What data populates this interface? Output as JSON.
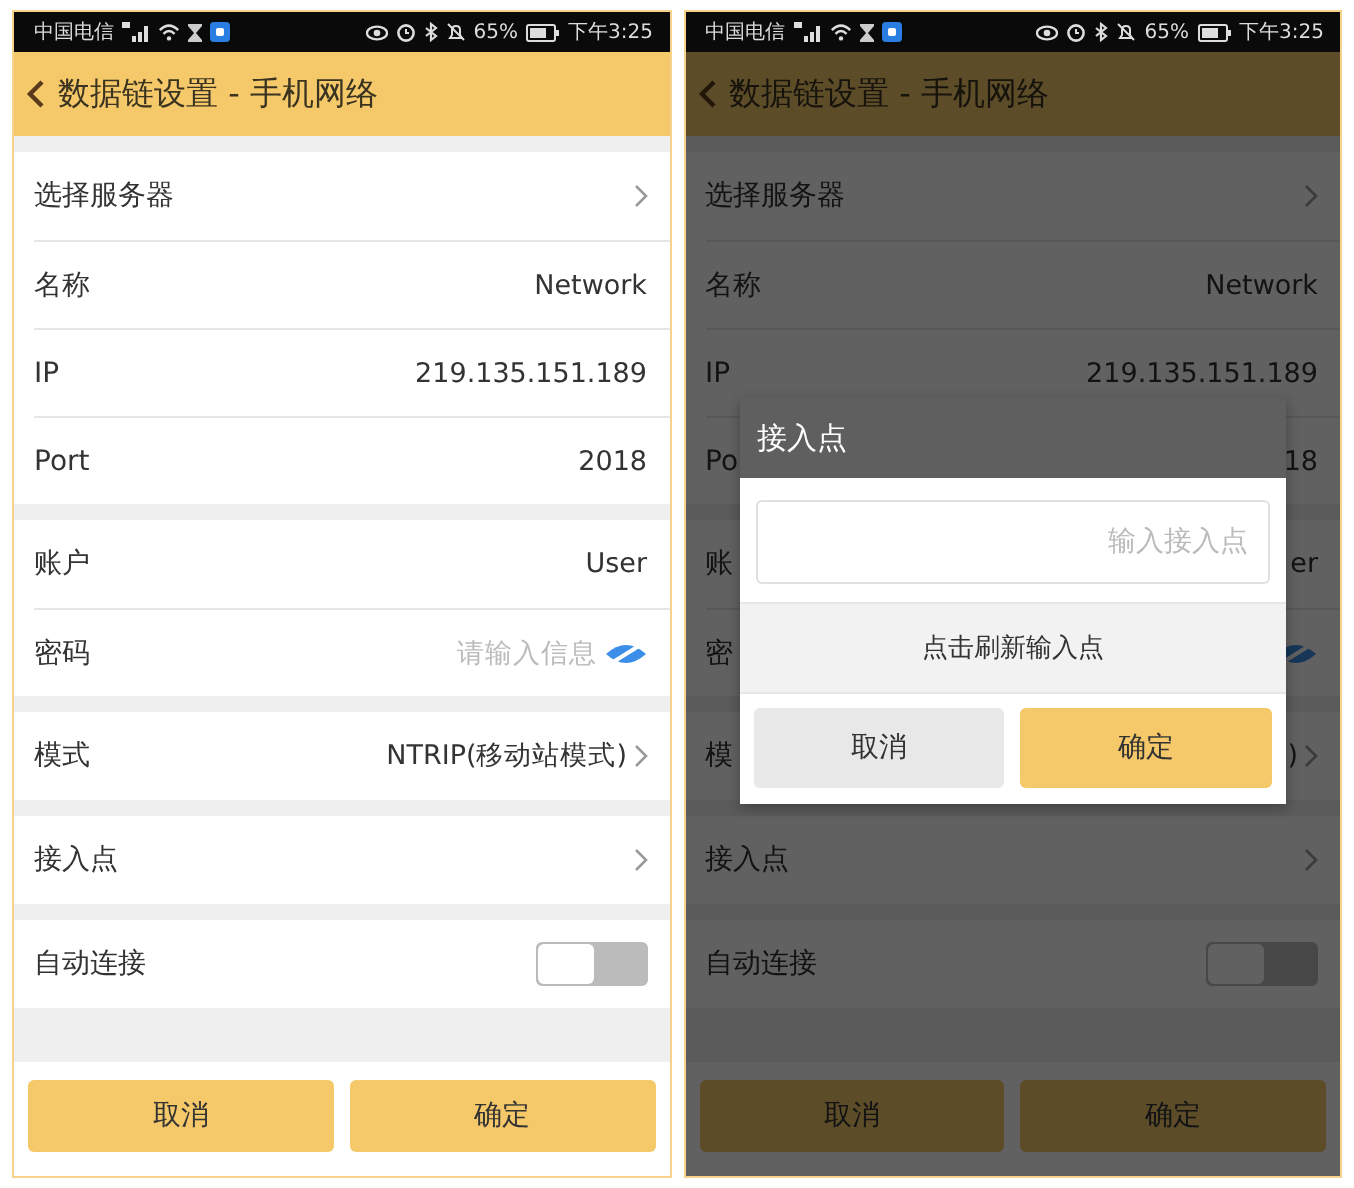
{
  "screens": [
    {
      "status_bar": {
        "carrier": "中国电信",
        "battery": "65%",
        "time": "下午3:25"
      },
      "header": {
        "title": "数据链设置 - 手机网络"
      },
      "groups": [
        {
          "rows": [
            {
              "kind": "link",
              "label": "选择服务器"
            },
            {
              "kind": "text",
              "label": "名称",
              "value": "Network"
            },
            {
              "kind": "text",
              "label": "IP",
              "value": "219.135.151.189"
            },
            {
              "kind": "text",
              "label": "Port",
              "value": "2018"
            }
          ]
        },
        {
          "rows": [
            {
              "kind": "text",
              "label": "账户",
              "value": "User"
            },
            {
              "kind": "password",
              "label": "密码",
              "placeholder": "请输入信息"
            }
          ]
        },
        {
          "rows": [
            {
              "kind": "link",
              "label": "模式",
              "value": "NTRIP(移动站模式)"
            }
          ]
        },
        {
          "rows": [
            {
              "kind": "link",
              "label": "接入点"
            }
          ]
        },
        {
          "rows": [
            {
              "kind": "toggle",
              "label": "自动连接",
              "on": false
            }
          ]
        }
      ],
      "buttons": [
        "取消",
        "确定"
      ]
    },
    {
      "status_bar": {
        "carrier": "中国电信",
        "battery": "65%",
        "time": "下午3:25"
      },
      "header": {
        "title": "数据链设置 - 手机网络"
      },
      "groups": [
        {
          "rows": [
            {
              "kind": "link",
              "label": "选择服务器"
            },
            {
              "kind": "text",
              "label": "名称",
              "value": "Network"
            },
            {
              "kind": "text",
              "label": "IP",
              "value": "219.135.151.189"
            },
            {
              "kind": "text",
              "label": "Po",
              "value": "18"
            }
          ]
        },
        {
          "rows": [
            {
              "kind": "text",
              "label": "账",
              "value": "er"
            },
            {
              "kind": "password",
              "label": "密"
            }
          ]
        },
        {
          "rows": [
            {
              "kind": "link",
              "label": "模",
              "value": ")"
            }
          ]
        },
        {
          "rows": [
            {
              "kind": "link",
              "label": "接入点"
            }
          ]
        },
        {
          "rows": [
            {
              "kind": "toggle",
              "label": "自动连接",
              "on": false
            }
          ]
        }
      ],
      "buttons": [
        "取消",
        "确定"
      ],
      "dialog": {
        "title": "接入点",
        "placeholder": "输入接入点",
        "refresh": "点击刷新输入点",
        "buttons": [
          {
            "label": "取消",
            "kind": "secondary"
          },
          {
            "label": "确定",
            "kind": "primary"
          }
        ]
      }
    }
  ]
}
